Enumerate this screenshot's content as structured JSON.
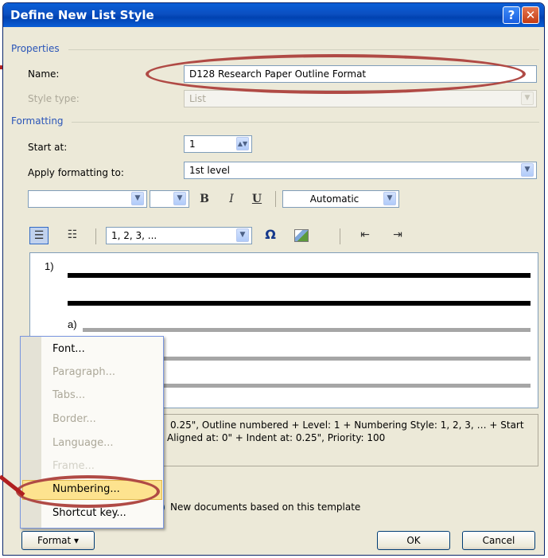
{
  "dialog": {
    "title": "Define New List Style",
    "help_glyph": "?",
    "close_glyph": "✕"
  },
  "properties": {
    "group_label": "Properties",
    "name_label": "Name:",
    "name_value": "D128 Research Paper Outline Format",
    "style_type_label": "Style type:",
    "style_type_value": "List"
  },
  "formatting": {
    "group_label": "Formatting",
    "start_at_label": "Start at:",
    "start_at_value": "1",
    "apply_label": "Apply formatting to:",
    "apply_value": "1st level",
    "font_name": "",
    "font_size": "",
    "bold_glyph": "B",
    "italic_glyph": "I",
    "underline_glyph": "U",
    "color_value": "Automatic",
    "number_style": "1, 2, 3, ...",
    "symbol_glyph": "Ω",
    "spin_glyph": "◆"
  },
  "preview": {
    "level1_marker": "1)",
    "level2_marker": "a)"
  },
  "description": {
    "line1": "0.25\", Outline numbered + Level: 1 + Numbering Style: 1, 2, 3, … + Start",
    "line2": "Aligned at:  0\" + Indent at:  0.25\", Priority: 100"
  },
  "options": {
    "new_docs_label": "New documents based on this template"
  },
  "context_menu": {
    "items": [
      {
        "label": "Font...",
        "enabled": true
      },
      {
        "label": "Paragraph...",
        "enabled": false
      },
      {
        "label": "Tabs...",
        "enabled": false
      },
      {
        "label": "Border...",
        "enabled": false
      },
      {
        "label": "Language...",
        "enabled": false
      },
      {
        "label": "Frame...",
        "enabled": false
      },
      {
        "label": "Numbering...",
        "enabled": true,
        "highlighted": true
      },
      {
        "label": "Shortcut key...",
        "enabled": true
      }
    ]
  },
  "footer": {
    "format_button": "Format ▾",
    "ok_button": "OK",
    "cancel_button": "Cancel"
  },
  "colors": {
    "annotation": "#b04a45",
    "titlebar": "#0b4fc1",
    "dialog_bg": "#ece9d8",
    "menu_highlight": "#fde38f"
  }
}
